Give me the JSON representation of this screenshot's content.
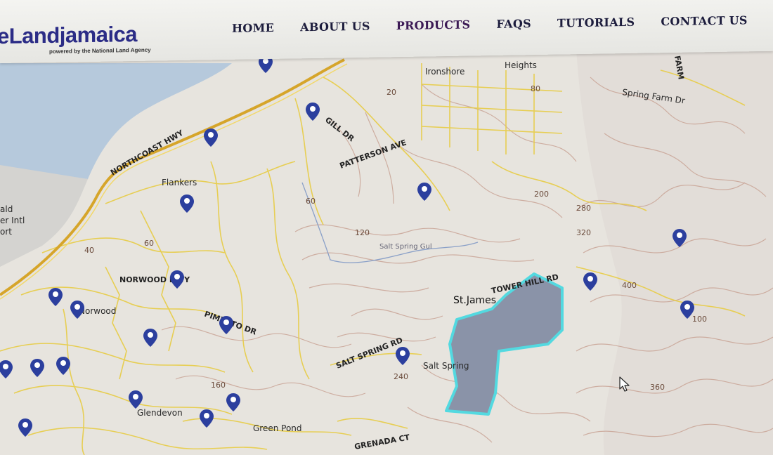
{
  "brand": {
    "logo": "eLandjamaica",
    "tagline": "powered by the National Land Agency"
  },
  "nav": {
    "items": [
      {
        "label": "HOME"
      },
      {
        "label": "ABOUT US"
      },
      {
        "label": "PRODUCTS"
      },
      {
        "label": "FAQS"
      },
      {
        "label": "TUTORIALS"
      },
      {
        "label": "CONTACT US"
      }
    ]
  },
  "map": {
    "roads": {
      "northcoast_hwy": "NORTHCOAST HWY",
      "gill_dr": "GILL DR",
      "patterson_ave": "PATTERSON AVE",
      "norwood_hwy": "NORWOOD HWY",
      "pimento_dr": "PIMENTO DR",
      "salt_spring_rd": "SALT SPRING RD",
      "tower_hill_rd": "TOWER HILL RD",
      "grenada_ct": "GRENADA CT",
      "spring_farm_dr": "Spring Farm Dr"
    },
    "places": {
      "ironshore": "Ironshore",
      "heights": "Heights",
      "flankers": "Flankers",
      "norwood": "Norwood",
      "st_james": "St.James",
      "salt_spring": "Salt Spring",
      "glendevon": "Glendevon",
      "green_pond": "Green Pond",
      "salt_spring_gully": "Salt Spring Gul",
      "airport_1": "ald",
      "airport_2": "er Intl",
      "airport_3": "ort",
      "farm": "FARM"
    },
    "contours": [
      "20",
      "80",
      "60",
      "120",
      "200",
      "280",
      "320",
      "40",
      "100",
      "160",
      "240",
      "400",
      "360",
      "60"
    ],
    "colors": {
      "water": "#b6c9dc",
      "land": "#e7e4de",
      "road": "#e8cc45",
      "highway": "#d6a52a",
      "contour": "#c9a496",
      "parcel_fill": "#8a93a8",
      "parcel_border": "#53d9e0",
      "marker": "#2c3f9e"
    }
  }
}
